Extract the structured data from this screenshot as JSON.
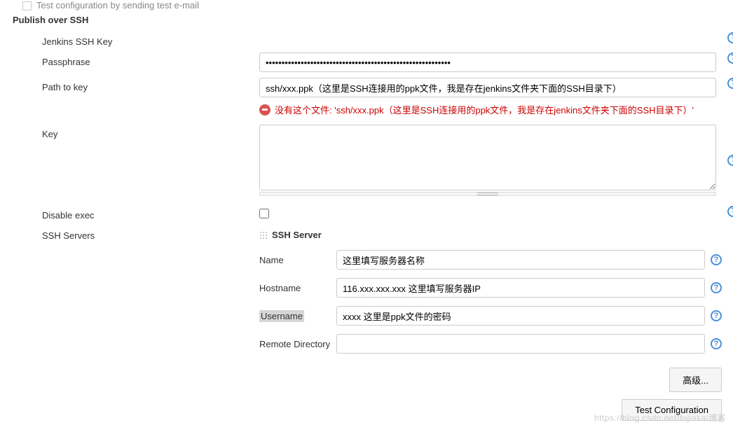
{
  "top": {
    "test_email_label": "Test configuration by sending test e-mail"
  },
  "section": {
    "title": "Publish over SSH"
  },
  "ssh_key": {
    "heading": "Jenkins SSH Key",
    "passphrase_label": "Passphrase",
    "passphrase_value": "••••••••••••••••••••••••••••••••••••••••••••••••••••••••••",
    "path_label": "Path to key",
    "path_value": "ssh/xxx.ppk（这里是SSH连接用的ppk文件，我是存在jenkins文件夹下面的SSH目录下）",
    "error_text": "没有这个文件: 'ssh/xxx.ppk（这里是SSH连接用的ppk文件，我是存在jenkins文件夹下面的SSH目录下）'",
    "key_label": "Key",
    "key_value": "",
    "disable_exec_label": "Disable exec"
  },
  "servers": {
    "label": "SSH Servers",
    "block_title": "SSH Server",
    "name_label": "Name",
    "name_value": "这里填写服务器名称",
    "hostname_label": "Hostname",
    "hostname_value": "116.xxx.xxx.xxx 这里填写服务器IP",
    "username_label": "Username",
    "username_value": "xxxx 这里是ppk文件的密码",
    "remote_dir_label": "Remote Directory",
    "remote_dir_value": ""
  },
  "buttons": {
    "advanced": "高级...",
    "test_config": "Test Configuration"
  },
  "watermark": "https://blog.csdn.net/fujiakai博客"
}
